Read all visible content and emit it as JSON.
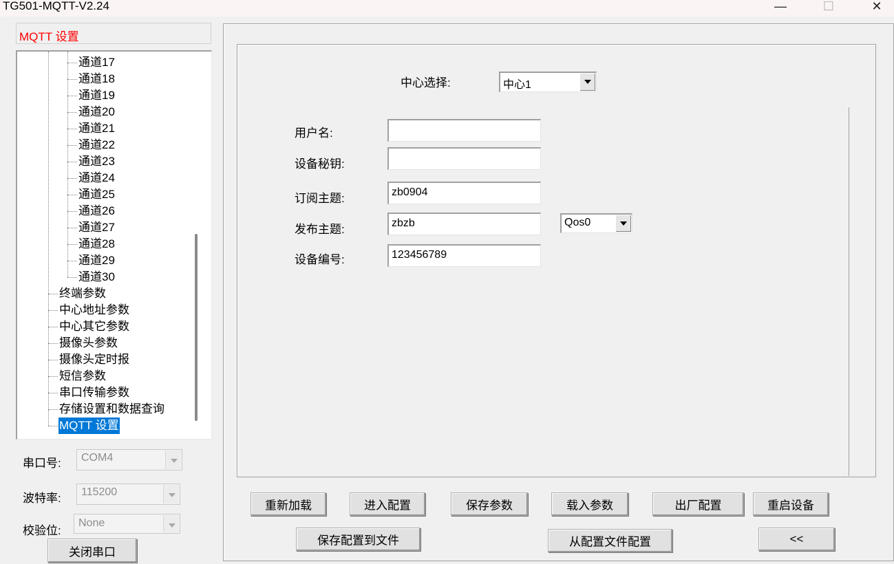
{
  "window": {
    "title": "TG501-MQTT-V2.24",
    "minimize_glyph": "—",
    "maximize_glyph": "☐",
    "close_glyph": "✕"
  },
  "left_panel": {
    "header": "MQTT 设置",
    "tree_items": [
      {
        "label": "通道17"
      },
      {
        "label": "通道18"
      },
      {
        "label": "通道19"
      },
      {
        "label": "通道20"
      },
      {
        "label": "通道21"
      },
      {
        "label": "通道22"
      },
      {
        "label": "通道23"
      },
      {
        "label": "通道24"
      },
      {
        "label": "通道25"
      },
      {
        "label": "通道26"
      },
      {
        "label": "通道27"
      },
      {
        "label": "通道28"
      },
      {
        "label": "通道29"
      },
      {
        "label": "通道30"
      },
      {
        "label": "终端参数"
      },
      {
        "label": "中心地址参数"
      },
      {
        "label": "中心其它参数"
      },
      {
        "label": "摄像头参数"
      },
      {
        "label": "摄像头定时报"
      },
      {
        "label": "短信参数"
      },
      {
        "label": "串口传输参数"
      },
      {
        "label": "存储设置和数据查询"
      },
      {
        "label": "MQTT 设置"
      }
    ],
    "selected_item": "MQTT 设置",
    "serial": {
      "port_label": "串口号:",
      "port_value": "COM4",
      "baud_label": "波特率:",
      "baud_value": "115200",
      "parity_label": "校验位:",
      "parity_value": "None",
      "close_button": "关闭串口"
    }
  },
  "mqtt_form": {
    "center_label": "中心选择:",
    "center_value": "中心1",
    "username_label": "用户名:",
    "username_value": "",
    "device_key_label": "设备秘钥:",
    "device_key_value": "",
    "subscribe_label": "订阅主题:",
    "subscribe_value": "zb0904",
    "publish_label": "发布主题:",
    "publish_value": "zbzb",
    "qos_value": "Qos0",
    "device_id_label": "设备编号:",
    "device_id_value": "123456789"
  },
  "buttons": {
    "reload": "重新加载",
    "enter_config": "进入配置",
    "save_params": "保存参数",
    "load_params": "载入参数",
    "factory_config": "出厂配置",
    "restart_device": "重启设备",
    "save_to_file": "保存配置到文件",
    "config_from_file": "从配置文件配置",
    "collapse": "<<"
  }
}
